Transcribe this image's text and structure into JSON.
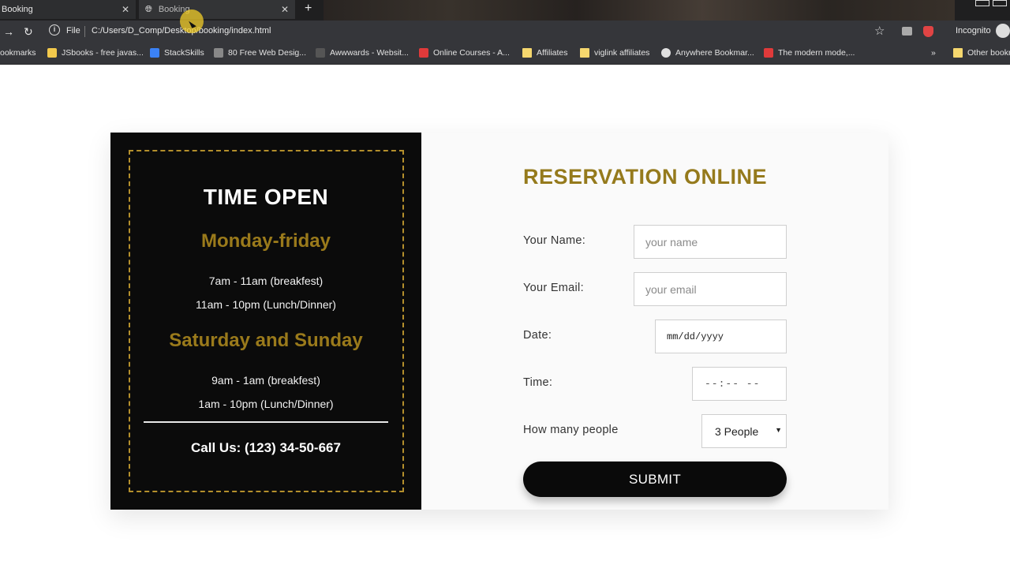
{
  "browser": {
    "tabs": [
      {
        "label": "Booking"
      },
      {
        "label": "Booking"
      }
    ],
    "new_tab_label": "+",
    "file_label": "File",
    "url": "C:/Users/D_Comp/Desktop/booking/index.html",
    "incognito_label": "Incognito",
    "bookmarks": [
      {
        "label": "ookmarks",
        "icon": "bookmark-icon"
      },
      {
        "label": "JSbooks - free javas...",
        "icon": "jsbooks-icon"
      },
      {
        "label": "StackSkills",
        "icon": "stackskills-icon"
      },
      {
        "label": "80 Free Web Desig...",
        "icon": "web-design-icon"
      },
      {
        "label": "Awwwards - Websit...",
        "icon": "awwwards-icon"
      },
      {
        "label": "Online Courses - A...",
        "icon": "online-courses-icon"
      },
      {
        "label": "Affiliates",
        "icon": "folder-icon"
      },
      {
        "label": "viglink affiliates",
        "icon": "folder-icon"
      },
      {
        "label": "Anywhere Bookmar...",
        "icon": "globe-icon"
      },
      {
        "label": "The modern mode,...",
        "icon": "modern-mode-icon"
      }
    ],
    "more_label": "»",
    "other_bookmarks_label": "Other bookm"
  },
  "hours": {
    "title": "TIME OPEN",
    "weekday_label": "Monday-friday",
    "weekday_hours": [
      "7am - 11am (breakfest)",
      "11am - 10pm (Lunch/Dinner)"
    ],
    "weekend_label": "Saturday and Sunday",
    "weekend_hours": [
      "9am - 1am (breakfest)",
      "1am - 10pm (Lunch/Dinner)"
    ],
    "call": "Call Us: (123) 34-50-667"
  },
  "form": {
    "title": "RESERVATION ONLINE",
    "name_label": "Your Name:",
    "name_placeholder": "your name",
    "email_label": "Your Email:",
    "email_placeholder": "your email",
    "date_label": "Date:",
    "date_value": "mm/dd/yyyy",
    "time_label": "Time:",
    "time_value": "--:-- --",
    "people_label": "How many people",
    "people_value": "3 People",
    "submit_label": "SUBMIT"
  },
  "colors": {
    "gold": "#957a1c",
    "panel": "#0b0b0b",
    "button": "#0a0a0a"
  }
}
